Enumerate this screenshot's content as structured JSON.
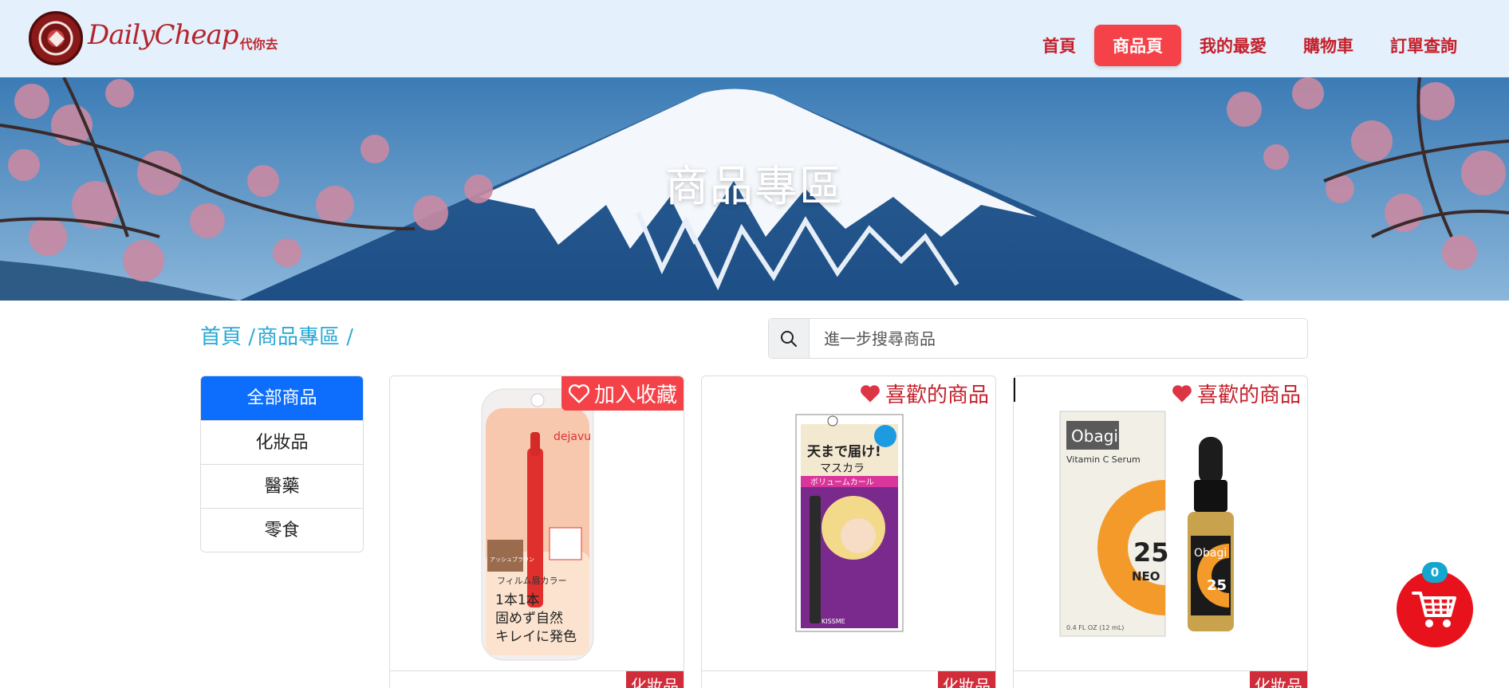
{
  "header": {
    "logo_script": "DailyCheap",
    "logo_sub": "代你去",
    "nav": [
      {
        "label": "首頁",
        "active": false
      },
      {
        "label": "商品頁",
        "active": true
      },
      {
        "label": "我的最愛",
        "active": false
      },
      {
        "label": "購物車",
        "active": false
      },
      {
        "label": "訂單查詢",
        "active": false
      }
    ]
  },
  "banner": {
    "title": "商品專區"
  },
  "breadcrumb": {
    "items": [
      "首頁 /",
      "商品專區 /"
    ]
  },
  "search": {
    "placeholder": "進一步搜尋商品",
    "value": ""
  },
  "categories": [
    {
      "label": "全部商品",
      "active": true
    },
    {
      "label": "化妝品",
      "active": false
    },
    {
      "label": "醫藥",
      "active": false
    },
    {
      "label": "零食",
      "active": false
    }
  ],
  "products": [
    {
      "favorite_label": "加入收藏",
      "favorited": false,
      "category": "化妝品",
      "image_text": [
        "dejavu",
        "フィルム眉カラー",
        "1本1本",
        "固めず自然",
        "キレイに発色",
        "アッシュブラウン"
      ]
    },
    {
      "favorite_label": "喜歡的商品",
      "favorited": true,
      "category": "化妝品",
      "image_text": [
        "天まで届け!",
        "マスカラ",
        "ボリュームカール",
        "KISSME"
      ]
    },
    {
      "favorite_label": "喜歡的商品",
      "favorited": true,
      "category": "化妝品",
      "image_text": [
        "Obagi",
        "Vitamin C Serum",
        "25",
        "NEO",
        "0.4 FL OZ (12 mL)"
      ]
    }
  ],
  "cart": {
    "count": "0"
  },
  "colors": {
    "accent_red": "#f44248",
    "nav_red": "#c4202b",
    "link_blue": "#29a9d6",
    "active_blue": "#0d6efd",
    "header_bg": "#e4f0fb"
  }
}
